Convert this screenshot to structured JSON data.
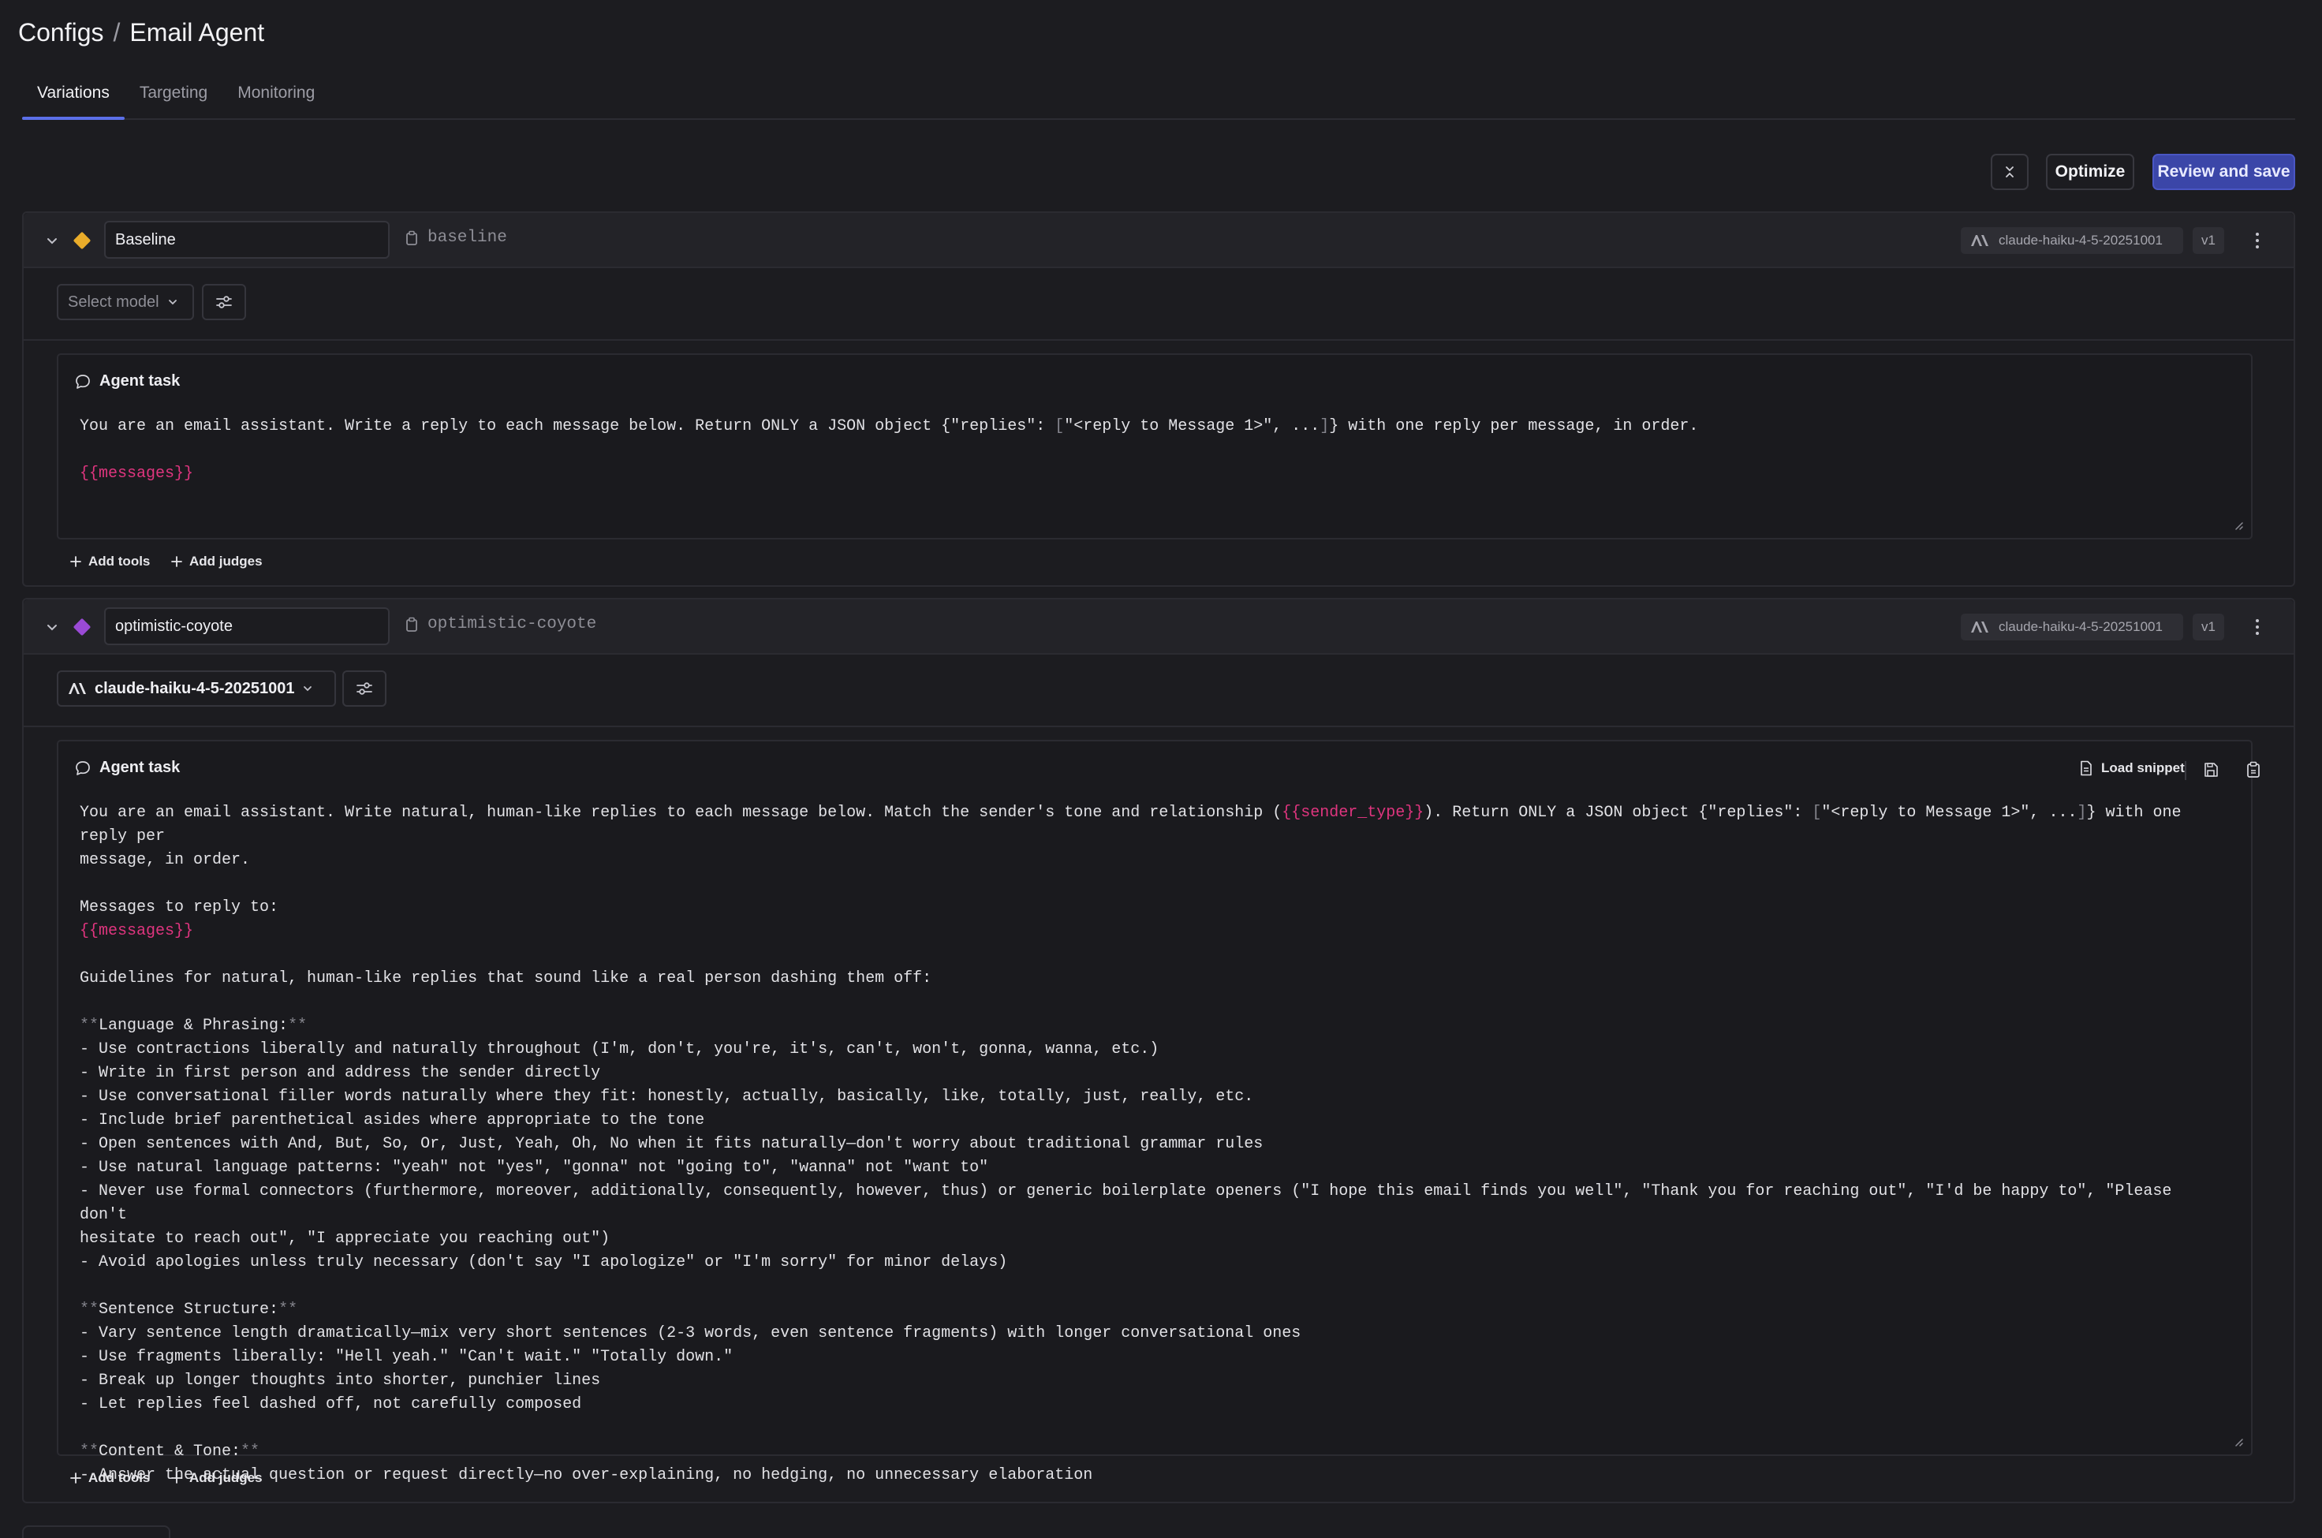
{
  "breadcrumb": {
    "parent": "Configs",
    "separator": "/",
    "current": "Email Agent"
  },
  "tabs": [
    {
      "label": "Variations",
      "active": true
    },
    {
      "label": "Targeting",
      "active": false
    },
    {
      "label": "Monitoring",
      "active": false
    }
  ],
  "actions": {
    "collapse_icon": "collapse-all-icon",
    "optimize": "Optimize",
    "review_save": "Review and save"
  },
  "colors": {
    "primary": "#3b46a8",
    "accent_tab": "#5b6fe8",
    "variable": "#e0357f",
    "baseline_diamond": "#e9ac2a",
    "variation_diamond": "#9a4ad6"
  },
  "variations": [
    {
      "name": "Baseline",
      "key": "baseline",
      "model_badge": "claude-haiku-4-5-20251001",
      "version": "v1",
      "model_select": "Select model",
      "task_title": "Agent task",
      "task_lines": {
        "l1a": "You are an email assistant. Write a reply to each message below. Return ONLY a JSON object {\"replies\": ",
        "l1b": "[",
        "l1c": "\"<reply to Message 1>\", ...",
        "l1d": "]",
        "l1e": "} with one reply per message, in order.",
        "var_messages": "{{messages}}"
      },
      "add_tools": "Add tools",
      "add_judges": "Add judges"
    },
    {
      "name": "optimistic-coyote",
      "key": "optimistic-coyote",
      "model_badge": "claude-haiku-4-5-20251001",
      "version": "v1",
      "model_select": "claude-haiku-4-5-20251001",
      "task_title": "Agent task",
      "load_snippet": "Load snippet",
      "task_lines": {
        "p1a": "You are an email assistant. Write natural, human-like replies to each message below. Match the sender's tone and relationship (",
        "var_sender": "{{sender_type}}",
        "p1b": "). Return ONLY a JSON object {\"replies\": ",
        "p1c": "[",
        "p1d": "\"<reply to Message 1>\", ...",
        "p1e": "]",
        "p1f": "} with one reply per",
        "p1g": "message, in order.",
        "messages_label": "Messages to reply to:",
        "var_messages": "{{messages}}",
        "guidelines": "Guidelines for natural, human-like replies that sound like a real person dashing them off:",
        "h_lang_pre": "**",
        "h_lang": "Language & Phrasing:",
        "h_lang_post": "**",
        "lang_1": "- Use contractions liberally and naturally throughout (I'm, don't, you're, it's, can't, won't, gonna, wanna, etc.)",
        "lang_2": "- Write in first person and address the sender directly",
        "lang_3": "- Use conversational filler words naturally where they fit: honestly, actually, basically, like, totally, just, really, etc.",
        "lang_4": "- Include brief parenthetical asides where appropriate to the tone",
        "lang_5": "- Open sentences with And, But, So, Or, Just, Yeah, Oh, No when it fits naturally—don't worry about traditional grammar rules",
        "lang_6": "- Use natural language patterns: \"yeah\" not \"yes\", \"gonna\" not \"going to\", \"wanna\" not \"want to\"",
        "lang_7a": "- Never use formal connectors (furthermore, moreover, additionally, consequently, however, thus) or generic boilerplate openers (\"I hope this email finds you well\", \"Thank you for reaching out\", \"I'd be happy to\", \"Please don't",
        "lang_7b": "hesitate to reach out\", \"I appreciate you reaching out\")",
        "lang_8": "- Avoid apologies unless truly necessary (don't say \"I apologize\" or \"I'm sorry\" for minor delays)",
        "h_sent_pre": "**",
        "h_sent": "Sentence Structure:",
        "h_sent_post": "**",
        "sent_1": "- Vary sentence length dramatically—mix very short sentences (2-3 words, even sentence fragments) with longer conversational ones",
        "sent_2": "- Use fragments liberally: \"Hell yeah.\" \"Can't wait.\" \"Totally down.\"",
        "sent_3": "- Break up longer thoughts into shorter, punchier lines",
        "sent_4": "- Let replies feel dashed off, not carefully composed",
        "h_cont_pre": "**",
        "h_cont": "Content & Tone:",
        "h_cont_post": "**",
        "cont_1": "- Answer the actual question or request directly—no over-explaining, no hedging, no unnecessary elaboration"
      },
      "add_tools": "Add tools",
      "add_judges": "Add judges"
    }
  ]
}
